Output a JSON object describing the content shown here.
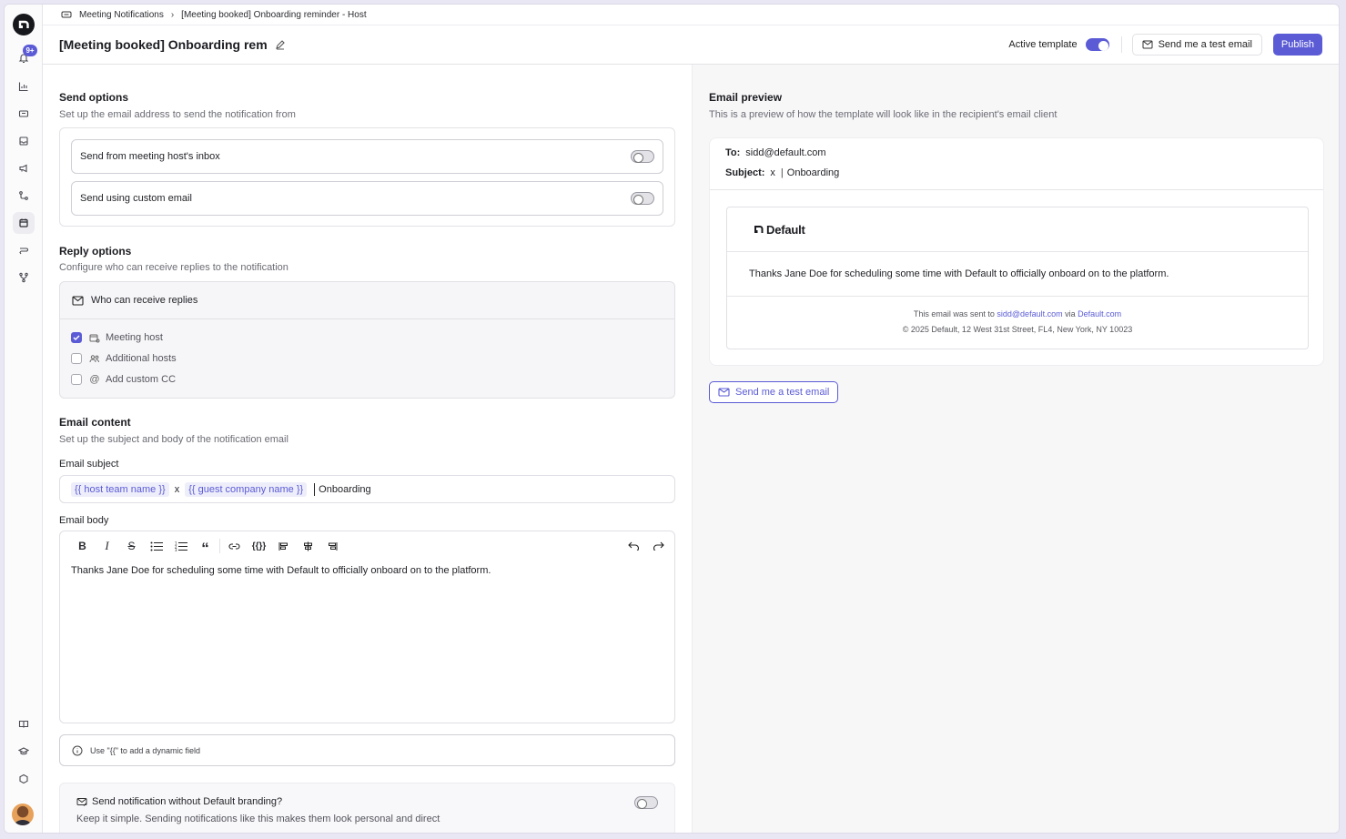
{
  "breadcrumb": {
    "parent": "Meeting Notifications",
    "current": "[Meeting booked] Onboarding reminder - Host"
  },
  "header": {
    "title": "[Meeting booked] Onboarding rem",
    "active_template_label": "Active template",
    "active_template_on": true,
    "send_test_label": "Send me a test email",
    "publish_label": "Publish"
  },
  "rail": {
    "notification_badge": "9+",
    "icons": [
      "bell-icon",
      "chart-icon",
      "ticket-icon",
      "inbox-icon",
      "megaphone-icon",
      "route-icon",
      "calendar-icon",
      "workflow-icon",
      "branch-icon",
      "book-icon",
      "graduation-icon",
      "hexagon-icon"
    ]
  },
  "send_options": {
    "title": "Send options",
    "subtitle": "Set up the email address to send the notification from",
    "host_inbox_label": "Send from meeting host's inbox",
    "host_inbox_on": false,
    "custom_email_label": "Send using custom email",
    "custom_email_on": false
  },
  "reply_options": {
    "title": "Reply options",
    "subtitle": "Configure who can receive replies to the notification",
    "who_label": "Who can receive replies",
    "options": [
      {
        "label": "Meeting host",
        "checked": true
      },
      {
        "label": "Additional hosts",
        "checked": false
      },
      {
        "label": "Add custom CC",
        "checked": false
      }
    ]
  },
  "email_content": {
    "title": "Email content",
    "subtitle": "Set up the subject and body of the notification email",
    "subject_label": "Email subject",
    "subject_chip_1": "{{ host team name }}",
    "subject_x": "x",
    "subject_chip_2": "{{ guest company name }}",
    "subject_suffix": "Onboarding",
    "body_label": "Email body",
    "body_text": "Thanks Jane Doe for scheduling some time with Default to officially onboard on to the platform.",
    "hint": "Use \"{{\" to add a dynamic field"
  },
  "branding": {
    "title": "Send notification without Default branding?",
    "subtitle": "Keep it simple. Sending notifications like this makes them look personal and direct",
    "on": false
  },
  "preview": {
    "title": "Email preview",
    "subtitle": "This is a preview of how the template will look like in the recipient's email client",
    "to_label": "To:",
    "to_value": "sidd@default.com",
    "subject_label": "Subject:",
    "subject_x": "x",
    "subject_value": "Onboarding",
    "brand_name": "Default",
    "body": "Thanks Jane Doe for scheduling some time with Default to officially onboard on to the platform.",
    "footer_prefix": "This email was sent to",
    "footer_email": "sidd@default.com",
    "footer_via": "via",
    "footer_site": "Default.com",
    "footer_address": "© 2025 Default, 12 West 31st Street, FL4, New York, NY 10023",
    "test_button": "Send me a test email"
  },
  "colors": {
    "accent": "#5b5bd6"
  }
}
